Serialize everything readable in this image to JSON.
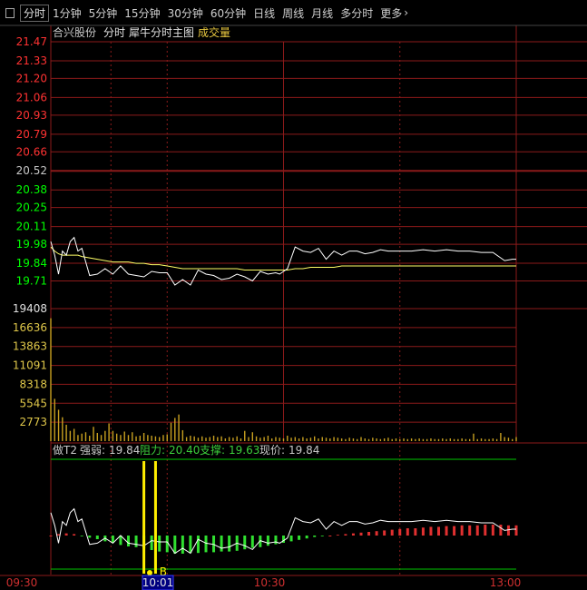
{
  "toolbar": {
    "icon": "panel-toggle-icon",
    "tabs": [
      {
        "label": "分时",
        "active": true
      },
      {
        "label": "1分钟"
      },
      {
        "label": "5分钟"
      },
      {
        "label": "15分钟"
      },
      {
        "label": "30分钟"
      },
      {
        "label": "60分钟"
      },
      {
        "label": "日线"
      },
      {
        "label": "周线"
      },
      {
        "label": "月线"
      },
      {
        "label": "多分时"
      },
      {
        "label": "更多"
      }
    ],
    "more_icon": "chevron-right-icon"
  },
  "price_panel": {
    "stock_name": "合兴股份",
    "mode": "分时",
    "indicator": "犀牛分时主图",
    "volume_label": "成交量"
  },
  "volume_panel": {
    "max_label": "19408"
  },
  "t2_panel": {
    "name": "做T2",
    "strength_label": "强弱:",
    "strength_value": "19.84",
    "resistance_label": "阻力:",
    "resistance_value": "20.40",
    "support_label": "支撑:",
    "support_value": "19.63",
    "price_label": "现价:",
    "price_value": "19.84",
    "marker": "B"
  },
  "colors": {
    "up": "#ff3232",
    "down": "#00ff00",
    "center": "#c8c8c8",
    "grid": "#8b1a1a",
    "avg": "#ffff66",
    "price": "#ffffff",
    "cursor_time_bg": "#000080"
  },
  "chart_data": [
    {
      "type": "line",
      "title": "",
      "x_time_labels": [
        "09:30",
        "10:01",
        "10:30",
        "13:00"
      ],
      "cursor_time": "10:01",
      "yticks": [
        "21.47",
        "21.33",
        "21.20",
        "21.06",
        "20.93",
        "20.79",
        "20.66",
        "20.52",
        "20.38",
        "20.25",
        "20.11",
        "19.98",
        "19.84",
        "19.71"
      ],
      "prev_close": 20.52,
      "ylim": [
        19.64,
        21.47
      ],
      "x_minutes": [
        0,
        2,
        4,
        6,
        8,
        10,
        12,
        14,
        16,
        20,
        24,
        28,
        32,
        36,
        40,
        44,
        48,
        52,
        56,
        60,
        64,
        68,
        72,
        76,
        80,
        84,
        88,
        92,
        96,
        100,
        104,
        108,
        112,
        116,
        118,
        122,
        126,
        130,
        134,
        138,
        142,
        146,
        150,
        154,
        158,
        162,
        166,
        170,
        174,
        180,
        186,
        192,
        198,
        204,
        210,
        216,
        222,
        228,
        234,
        238,
        240
      ],
      "series": [
        {
          "name": "price",
          "values": [
            20.0,
            19.9,
            19.76,
            19.93,
            19.9,
            20.0,
            20.03,
            19.93,
            19.95,
            19.75,
            19.76,
            19.8,
            19.76,
            19.82,
            19.76,
            19.75,
            19.74,
            19.78,
            19.77,
            19.77,
            19.68,
            19.72,
            19.68,
            19.79,
            19.76,
            19.75,
            19.72,
            19.73,
            19.76,
            19.74,
            19.71,
            19.78,
            19.76,
            19.77,
            19.76,
            19.8,
            19.96,
            19.93,
            19.92,
            19.95,
            19.87,
            19.93,
            19.9,
            19.93,
            19.93,
            19.91,
            19.92,
            19.94,
            19.93,
            19.93,
            19.93,
            19.94,
            19.93,
            19.94,
            19.93,
            19.93,
            19.92,
            19.92,
            19.86,
            19.87,
            19.87
          ]
        },
        {
          "name": "average",
          "values": [
            19.96,
            19.93,
            19.91,
            19.9,
            19.9,
            19.9,
            19.9,
            19.9,
            19.89,
            19.88,
            19.87,
            19.86,
            19.85,
            19.85,
            19.85,
            19.84,
            19.84,
            19.83,
            19.83,
            19.82,
            19.81,
            19.8,
            19.8,
            19.8,
            19.8,
            19.8,
            19.8,
            19.8,
            19.8,
            19.79,
            19.79,
            19.79,
            19.79,
            19.79,
            19.79,
            19.79,
            19.8,
            19.8,
            19.81,
            19.81,
            19.81,
            19.81,
            19.82,
            19.82,
            19.82,
            19.82,
            19.82,
            19.82,
            19.82,
            19.82,
            19.82,
            19.82,
            19.82,
            19.82,
            19.82,
            19.82,
            19.82,
            19.82,
            19.82,
            19.82,
            19.82
          ]
        }
      ]
    },
    {
      "type": "bar",
      "title": "",
      "yticks": [
        "16636",
        "13863",
        "11091",
        "8318",
        "5545",
        "2773"
      ],
      "ylim": [
        0,
        19408
      ],
      "x_minutes": [
        0,
        2,
        4,
        6,
        8,
        10,
        12,
        14,
        16,
        18,
        20,
        22,
        24,
        26,
        28,
        30,
        32,
        34,
        36,
        38,
        40,
        42,
        44,
        46,
        48,
        50,
        52,
        54,
        56,
        58,
        60,
        62,
        64,
        66,
        68,
        70,
        72,
        74,
        76,
        78,
        80,
        82,
        84,
        86,
        88,
        90,
        92,
        94,
        96,
        98,
        100,
        102,
        104,
        106,
        108,
        110,
        112,
        114,
        116,
        118,
        120,
        122,
        124,
        126,
        128,
        130,
        132,
        134,
        136,
        138,
        140,
        142,
        144,
        146,
        148,
        150,
        152,
        154,
        156,
        158,
        160,
        162,
        164,
        166,
        168,
        170,
        172,
        174,
        176,
        178,
        180,
        182,
        184,
        186,
        188,
        190,
        192,
        194,
        196,
        198,
        200,
        202,
        204,
        206,
        208,
        210,
        212,
        214,
        216,
        218,
        220,
        222,
        224,
        226,
        228,
        230,
        232,
        234,
        236,
        238,
        240
      ],
      "series": [
        {
          "name": "volume",
          "values": [
            18000,
            6200,
            4600,
            3500,
            2400,
            1500,
            1800,
            900,
            1100,
            1300,
            800,
            2100,
            1200,
            900,
            1500,
            2600,
            1500,
            1100,
            900,
            1400,
            900,
            1300,
            700,
            800,
            1200,
            900,
            800,
            700,
            600,
            900,
            1000,
            2700,
            3400,
            3900,
            1600,
            600,
            800,
            700,
            500,
            700,
            500,
            600,
            800,
            600,
            700,
            400,
            600,
            500,
            700,
            400,
            1500,
            600,
            1300,
            700,
            500,
            600,
            800,
            400,
            600,
            500,
            400,
            800,
            500,
            600,
            400,
            600,
            400,
            500,
            700,
            400,
            600,
            500,
            400,
            600,
            500,
            400,
            300,
            500,
            400,
            300,
            600,
            400,
            300,
            500,
            400,
            300,
            400,
            500,
            300,
            400,
            300,
            400,
            300,
            400,
            300,
            400,
            300,
            300,
            400,
            300,
            300,
            400,
            300,
            400,
            300,
            300,
            400,
            300,
            300,
            1100,
            300,
            400,
            300,
            300,
            400,
            300,
            1200,
            600,
            500,
            300,
            600
          ]
        }
      ]
    },
    {
      "type": "bar",
      "title": "做T2",
      "x_minutes": [
        0,
        4,
        8,
        12,
        16,
        20,
        24,
        28,
        32,
        36,
        40,
        44,
        48,
        52,
        56,
        60,
        64,
        68,
        72,
        76,
        80,
        84,
        88,
        92,
        96,
        100,
        104,
        108,
        112,
        116,
        120,
        124,
        128,
        132,
        136,
        140,
        144,
        148,
        152,
        156,
        160,
        164,
        168,
        172,
        176,
        180,
        184,
        188,
        192,
        196,
        200,
        204,
        208,
        212,
        216,
        220,
        224,
        228,
        232,
        236,
        240
      ],
      "series": [
        {
          "name": "divergence",
          "values": [
            0.0,
            0.02,
            0.03,
            0.02,
            -0.01,
            -0.03,
            -0.05,
            -0.08,
            -0.1,
            -0.13,
            -0.15,
            -0.16,
            -0.18,
            -0.2,
            -0.22,
            -0.23,
            -0.25,
            -0.25,
            -0.24,
            -0.24,
            -0.23,
            -0.23,
            -0.22,
            -0.22,
            -0.21,
            -0.19,
            -0.17,
            -0.16,
            -0.14,
            -0.12,
            -0.1,
            -0.08,
            -0.06,
            -0.04,
            -0.02,
            -0.01,
            0.0,
            0.01,
            0.02,
            0.03,
            0.04,
            0.05,
            0.06,
            0.07,
            0.08,
            0.09,
            0.1,
            0.1,
            0.11,
            0.12,
            0.12,
            0.13,
            0.13,
            0.14,
            0.14,
            0.14,
            0.15,
            0.15,
            0.15,
            0.14,
            0.14
          ]
        }
      ]
    }
  ]
}
